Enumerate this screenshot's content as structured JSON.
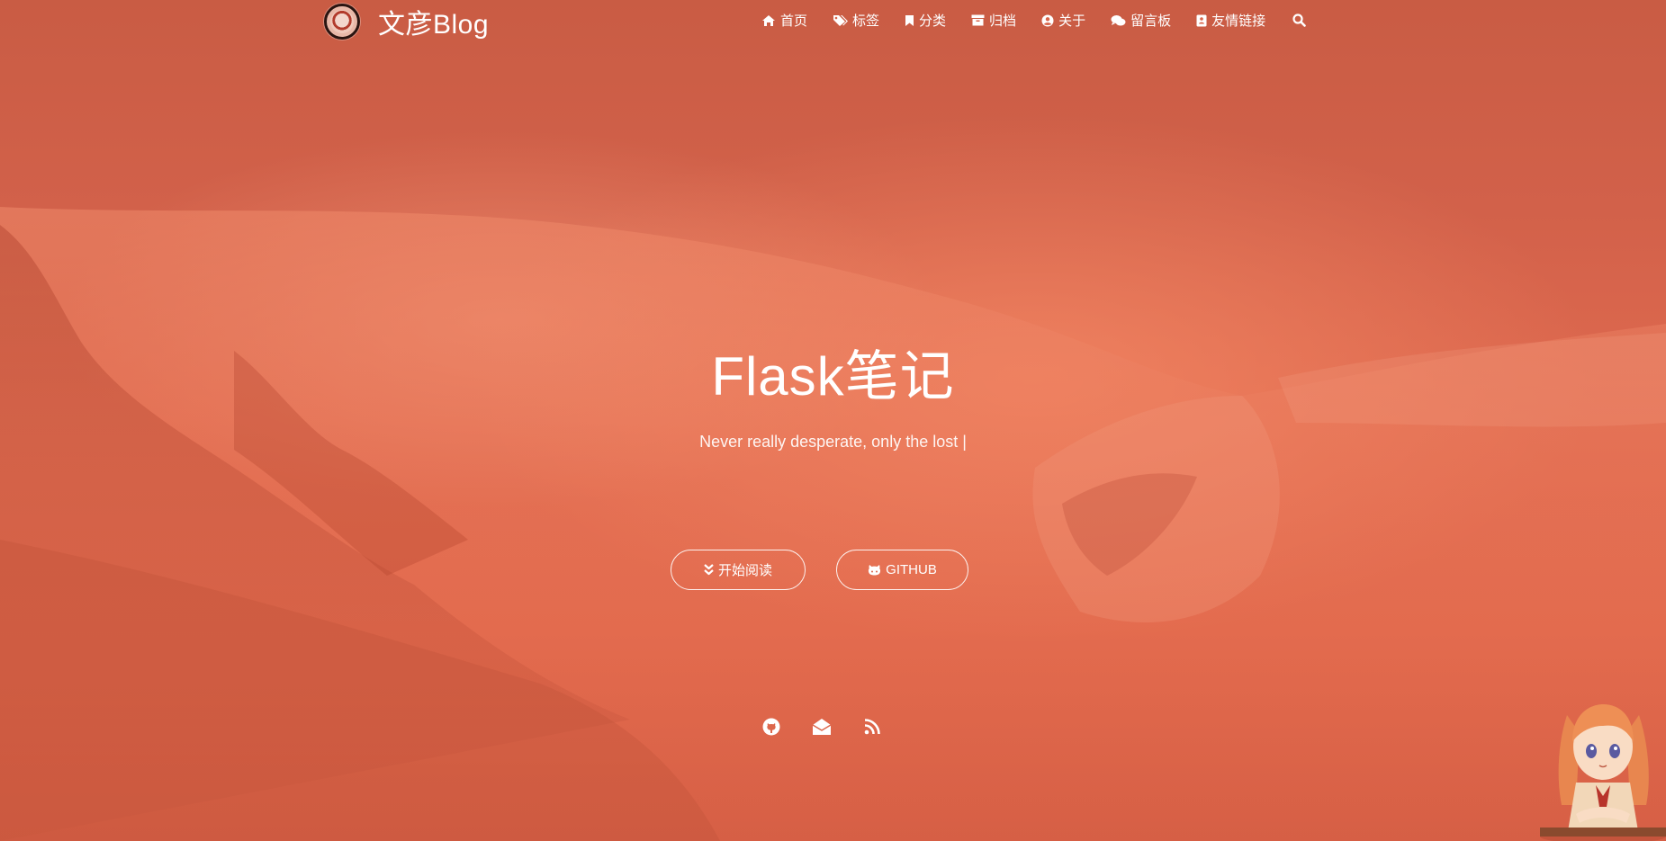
{
  "brand": {
    "title": "文彦Blog"
  },
  "nav": {
    "items": [
      {
        "label": "首页",
        "icon": "home-icon"
      },
      {
        "label": "标签",
        "icon": "tags-icon"
      },
      {
        "label": "分类",
        "icon": "bookmark-icon"
      },
      {
        "label": "归档",
        "icon": "archive-icon"
      },
      {
        "label": "关于",
        "icon": "user-circle-icon"
      },
      {
        "label": "留言板",
        "icon": "comments-icon"
      },
      {
        "label": "友情链接",
        "icon": "address-book-icon"
      }
    ],
    "search_icon": "search-icon"
  },
  "hero": {
    "title": "Flask笔记",
    "subtitle": "Never really desperate, only the lost |",
    "read_button": "开始阅读",
    "github_button": "GITHUB"
  },
  "social": [
    "github-icon",
    "envelope-icon",
    "rss-icon"
  ],
  "colors": {
    "background": "#e0694e",
    "text": "#ffffff"
  }
}
